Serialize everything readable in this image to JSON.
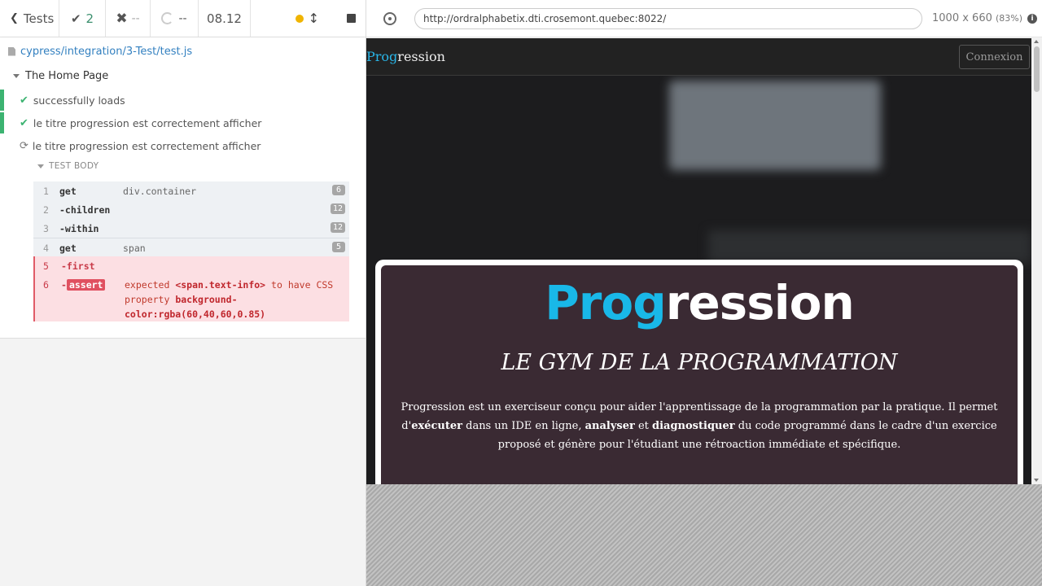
{
  "reporter": {
    "tests_label": "Tests",
    "passed": "2",
    "failed": "--",
    "pending": "--",
    "duration": "08.12",
    "spec_path": "cypress/integration/3-Test/test.js",
    "suite_title": "The Home Page",
    "tests": [
      {
        "title": "successfully loads",
        "state": "passed"
      },
      {
        "title": "le titre progression est correctement afficher",
        "state": "passed"
      },
      {
        "title": "le titre progression est correctement afficher",
        "state": "running"
      }
    ],
    "test_body_label": "TEST BODY",
    "commands": [
      {
        "num": "1",
        "name": "get",
        "message": "div.container",
        "count": "6"
      },
      {
        "num": "2",
        "name": "-children",
        "message": "",
        "count": "12"
      },
      {
        "num": "3",
        "name": "-within",
        "message": "",
        "count": "12"
      },
      {
        "num": "4",
        "name": "get",
        "message": "span",
        "count": "5"
      },
      {
        "num": "5",
        "name": "-first",
        "message": "",
        "count": ""
      },
      {
        "num": "6",
        "name": "assert",
        "dash": "-",
        "msg_expected": "expected",
        "msg_selector": "<span.text-info>",
        "msg_to_have": "to have",
        "msg_css": "CSS property",
        "msg_prop": "background-",
        "msg_value": "color:rgba(60,40,60,0.85)"
      }
    ]
  },
  "aut": {
    "url": "http://ordralphabetix.dti.crosemont.quebec:8022/",
    "viewport_size": "1000 x 660",
    "viewport_scale": "(83%)",
    "info_icon": "i",
    "page": {
      "brand_prefix": "Prog",
      "brand_suffix": "ression",
      "login_button": "Connexion",
      "hero_title_prefix": "Prog",
      "hero_title_suffix": "ression",
      "hero_subtitle": "LE GYM DE LA PROGRAMMATION",
      "hero_text_1": "Progression est un exerciseur conçu pour aider l'apprentissage de la programmation par la pratique. Il permet d'",
      "hero_text_bold_1": "exécuter",
      "hero_text_2": " dans un IDE en ligne, ",
      "hero_text_bold_2": "analyser",
      "hero_text_3": " et ",
      "hero_text_bold_3": "diagnostiquer",
      "hero_text_4": " du code programmé dans le cadre d'un exercice proposé et génère pour l'étudiant une rétroaction immédiate et spécifique."
    }
  },
  "colors": {
    "accent": "#19b8e8",
    "passed": "#3cb371",
    "failed": "#e05060",
    "hero_bg": "#3a2a33"
  }
}
